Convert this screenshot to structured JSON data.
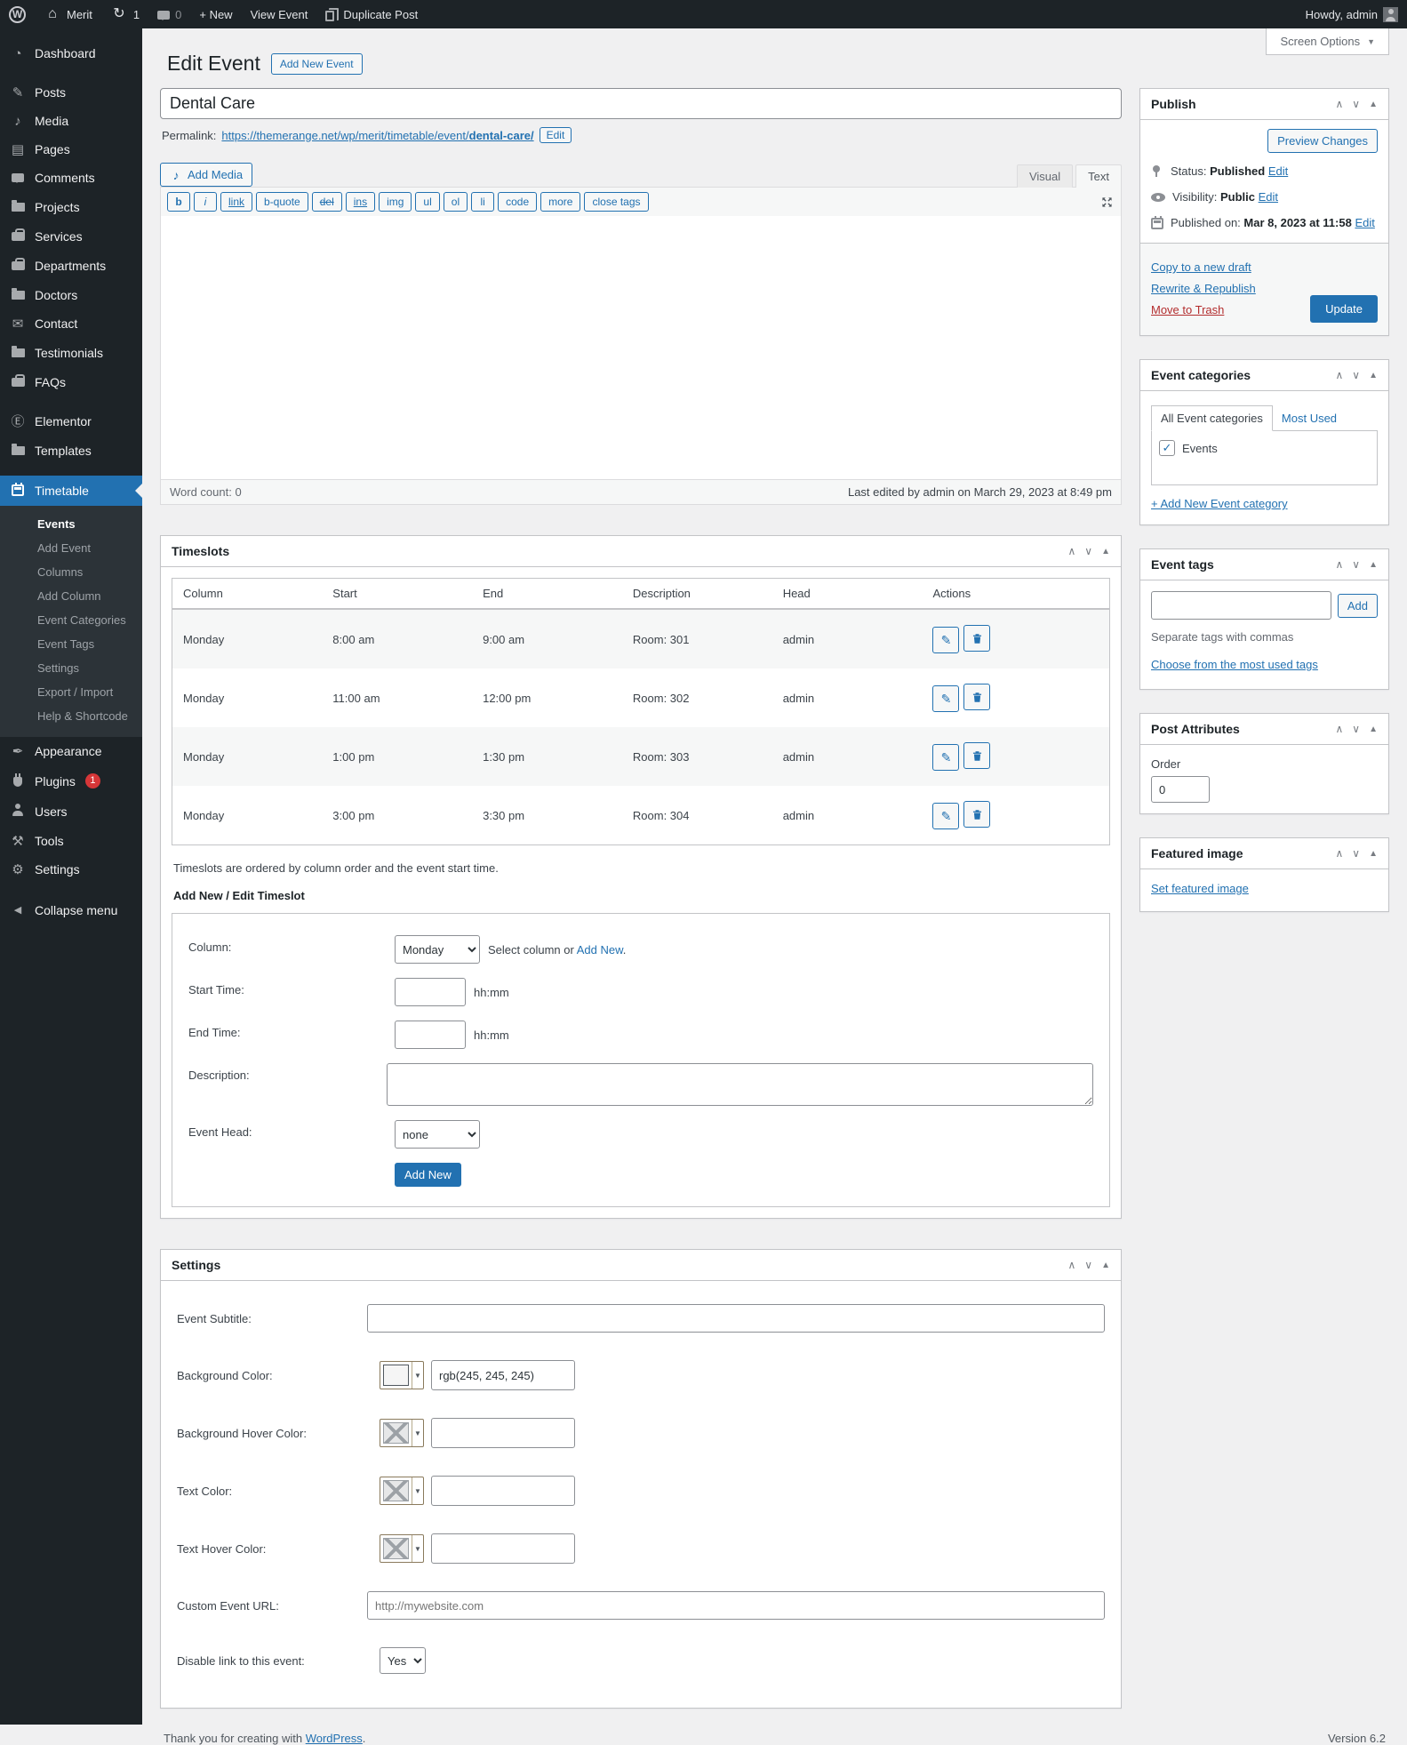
{
  "icons": {
    "wp": "W",
    "home": "⌂",
    "refresh": "↻",
    "dashboard": "◔",
    "posts": "✎",
    "media": "♪",
    "pages": "▤",
    "contact": "✉",
    "elementor": "Ⓔ",
    "appearance": "✒",
    "tools": "⚒",
    "settings": "⚙",
    "collapse": "◀",
    "pencil": "✎",
    "check": "✓",
    "screen_arrow": "▼",
    "panel_up": "∧",
    "panel_down": "∨",
    "panel_toggle": "▲"
  },
  "admin_bar": {
    "site_name": "Merit",
    "updates_count": "1",
    "comments_count": "0",
    "new_label": "+ New",
    "view_event_label": "View Event",
    "duplicate_label": "Duplicate Post",
    "howdy": "Howdy, admin"
  },
  "sidebar": {
    "items": [
      {
        "label": "Dashboard"
      },
      {
        "label": "Posts"
      },
      {
        "label": "Media"
      },
      {
        "label": "Pages"
      },
      {
        "label": "Comments"
      },
      {
        "label": "Projects"
      },
      {
        "label": "Services"
      },
      {
        "label": "Departments"
      },
      {
        "label": "Doctors"
      },
      {
        "label": "Contact"
      },
      {
        "label": "Testimonials"
      },
      {
        "label": "FAQs"
      },
      {
        "label": "Elementor"
      },
      {
        "label": "Templates"
      },
      {
        "label": "Timetable"
      },
      {
        "label": "Appearance"
      },
      {
        "label": "Plugins"
      },
      {
        "label": "Users"
      },
      {
        "label": "Tools"
      },
      {
        "label": "Settings"
      },
      {
        "label": "Collapse menu"
      }
    ],
    "plugins_badge": "1",
    "submenu": [
      {
        "label": "Events"
      },
      {
        "label": "Add Event"
      },
      {
        "label": "Columns"
      },
      {
        "label": "Add Column"
      },
      {
        "label": "Event Categories"
      },
      {
        "label": "Event Tags"
      },
      {
        "label": "Settings"
      },
      {
        "label": "Export / Import"
      },
      {
        "label": "Help & Shortcode"
      }
    ]
  },
  "page": {
    "title": "Edit Event",
    "add_new_button": "Add New Event",
    "screen_options": "Screen Options"
  },
  "editor": {
    "title_value": "Dental Care",
    "permalink_label": "Permalink:",
    "permalink_url": "https://themerange.net/wp/merit/timetable/event/",
    "permalink_slug": "dental-care/",
    "permalink_edit": "Edit",
    "add_media": "Add Media",
    "tab_visual": "Visual",
    "tab_text": "Text",
    "quicktags": [
      "b",
      "i",
      "link",
      "b-quote",
      "del",
      "ins",
      "img",
      "ul",
      "ol",
      "li",
      "code",
      "more",
      "close tags"
    ],
    "word_count_label": "Word count:",
    "word_count": "0",
    "last_edited": "Last edited by admin on March 29, 2023 at 8:49 pm"
  },
  "timeslots": {
    "title": "Timeslots",
    "columns": [
      "Column",
      "Start",
      "End",
      "Description",
      "Head",
      "Actions"
    ],
    "rows": [
      {
        "column": "Monday",
        "start": "8:00 am",
        "end": "9:00 am",
        "description": "Room: 301",
        "head": "admin"
      },
      {
        "column": "Monday",
        "start": "11:00 am",
        "end": "12:00 pm",
        "description": "Room: 302",
        "head": "admin"
      },
      {
        "column": "Monday",
        "start": "1:00 pm",
        "end": "1:30 pm",
        "description": "Room: 303",
        "head": "admin"
      },
      {
        "column": "Monday",
        "start": "3:00 pm",
        "end": "3:30 pm",
        "description": "Room: 304",
        "head": "admin"
      }
    ],
    "note": "Timeslots are ordered by column order and the event start time.",
    "form_title": "Add New / Edit Timeslot",
    "form": {
      "column_label": "Column:",
      "column_value": "Monday",
      "column_hint_prefix": "Select column or",
      "column_hint_link": "Add New",
      "column_hint_period": ".",
      "start_label": "Start Time:",
      "end_label": "End Time:",
      "time_hint": "hh:mm",
      "description_label": "Description:",
      "head_label": "Event Head:",
      "head_value": "none",
      "submit": "Add New"
    }
  },
  "settings_panel": {
    "title": "Settings",
    "subtitle_label": "Event Subtitle:",
    "bg_label": "Background Color:",
    "bg_value": "rgb(245, 245, 245)",
    "bg_hover_label": "Background Hover Color:",
    "text_label": "Text Color:",
    "text_hover_label": "Text Hover Color:",
    "url_label": "Custom Event URL:",
    "url_placeholder": "http://mywebsite.com",
    "disable_label": "Disable link to this event:",
    "disable_value": "Yes",
    "swatch_color": "#f5f5f5"
  },
  "publish": {
    "title": "Publish",
    "preview_button": "Preview Changes",
    "status_label": "Status:",
    "status_value": "Published",
    "visibility_label": "Visibility:",
    "visibility_value": "Public",
    "published_label": "Published on:",
    "published_value": "Mar 8, 2023 at 11:58",
    "edit": "Edit",
    "copy_draft": "Copy to a new draft",
    "rewrite": "Rewrite & Republish",
    "trash": "Move to Trash",
    "update_button": "Update"
  },
  "categories": {
    "title": "Event categories",
    "tab_all": "All Event categories",
    "tab_used": "Most Used",
    "item": "Events",
    "add_new": "+ Add New Event category"
  },
  "tags": {
    "title": "Event tags",
    "add_button": "Add",
    "hint": "Separate tags with commas",
    "choose_link": "Choose from the most used tags"
  },
  "post_attributes": {
    "title": "Post Attributes",
    "order_label": "Order",
    "order_value": "0"
  },
  "featured": {
    "title": "Featured image",
    "set_link": "Set featured image"
  },
  "footer": {
    "thanks_prefix": "Thank you for creating with",
    "wordpress": "WordPress",
    "period": ".",
    "version": "Version 6.2"
  }
}
